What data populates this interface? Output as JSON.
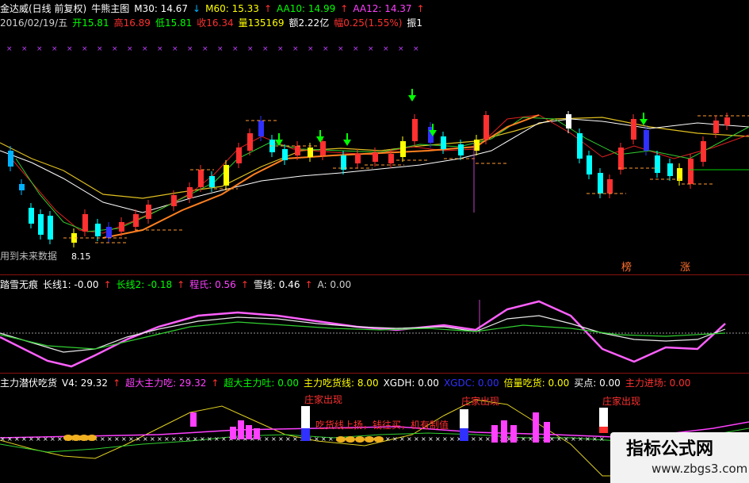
{
  "header": {
    "line1": [
      {
        "t": "金达威(日线 前复权)",
        "c": "#ffffff"
      },
      {
        "t": "牛熊主图",
        "c": "#ffffff"
      },
      {
        "t": "M30: 14.67",
        "c": "#ffffff"
      },
      {
        "t": "↓",
        "c": "#00b3ff"
      },
      {
        "t": "M60: 15.33",
        "c": "#ffff00"
      },
      {
        "t": "↑",
        "c": "#ff3030"
      },
      {
        "t": "AA10: 14.99",
        "c": "#00ff00"
      },
      {
        "t": "↑",
        "c": "#ff3030"
      },
      {
        "t": "AA12: 14.37",
        "c": "#ff40ff"
      },
      {
        "t": "↑",
        "c": "#ff3030"
      }
    ],
    "line2": [
      {
        "t": "2016/02/19/五",
        "c": "#cfcfcf"
      },
      {
        "t": "开15.81",
        "c": "#00ff00"
      },
      {
        "t": "高16.89",
        "c": "#ff3030"
      },
      {
        "t": "低15.81",
        "c": "#00ff00"
      },
      {
        "t": "收16.34",
        "c": "#ff3030"
      },
      {
        "t": "量135169",
        "c": "#ffff00"
      },
      {
        "t": "额2.22亿",
        "c": "#ffffff"
      },
      {
        "t": "幅0.25(1.55%)",
        "c": "#ff3030"
      },
      {
        "t": "振1.",
        "c": "#ffffff"
      }
    ]
  },
  "main_chart": {
    "note_left": "用到未来数据",
    "low_label": "8.15",
    "label_bang": "榜",
    "label_zhang": "涨"
  },
  "indicator1": {
    "items": [
      {
        "t": "踏雪无痕",
        "c": "#ffffff"
      },
      {
        "t": "长线1: -0.00",
        "c": "#ffffff"
      },
      {
        "t": "↑",
        "c": "#ff3030"
      },
      {
        "t": "长线2: -0.18",
        "c": "#00ff00"
      },
      {
        "t": "↑",
        "c": "#ff3030"
      },
      {
        "t": "程氏: 0.56",
        "c": "#ff40ff"
      },
      {
        "t": "↑",
        "c": "#ff3030"
      },
      {
        "t": "雪线: 0.46",
        "c": "#ffffff"
      },
      {
        "t": "↑",
        "c": "#ff3030"
      },
      {
        "t": "A: 0.00",
        "c": "#cfcfcf"
      }
    ]
  },
  "indicator2": {
    "items": [
      {
        "t": "主力潜伏吃货",
        "c": "#ffffff"
      },
      {
        "t": "V4: 29.32",
        "c": "#ffffff"
      },
      {
        "t": "↑",
        "c": "#ff3030"
      },
      {
        "t": "超大主力吃: 29.32",
        "c": "#ff40ff"
      },
      {
        "t": "↑",
        "c": "#ff3030"
      },
      {
        "t": "超大主力吐: 0.00",
        "c": "#00ff00"
      },
      {
        "t": "主力吃货线: 8.00",
        "c": "#ffff00"
      },
      {
        "t": "XGDH: 0.00",
        "c": "#ffffff"
      },
      {
        "t": "XGDC: 0.00",
        "c": "#3030ff"
      },
      {
        "t": "倍量吃货: 0.00",
        "c": "#ffff00"
      },
      {
        "t": "买点: 0.00",
        "c": "#ffffff"
      },
      {
        "t": "主力进场: 0.00",
        "c": "#ff3030"
      }
    ],
    "tag_zhuangjia": "庄家出现",
    "tag_chihuo": "吃货线上扬，钱往买，机有制值"
  },
  "watermark": {
    "title": "指标公式网",
    "url": "www.zbgs3.com"
  }
}
